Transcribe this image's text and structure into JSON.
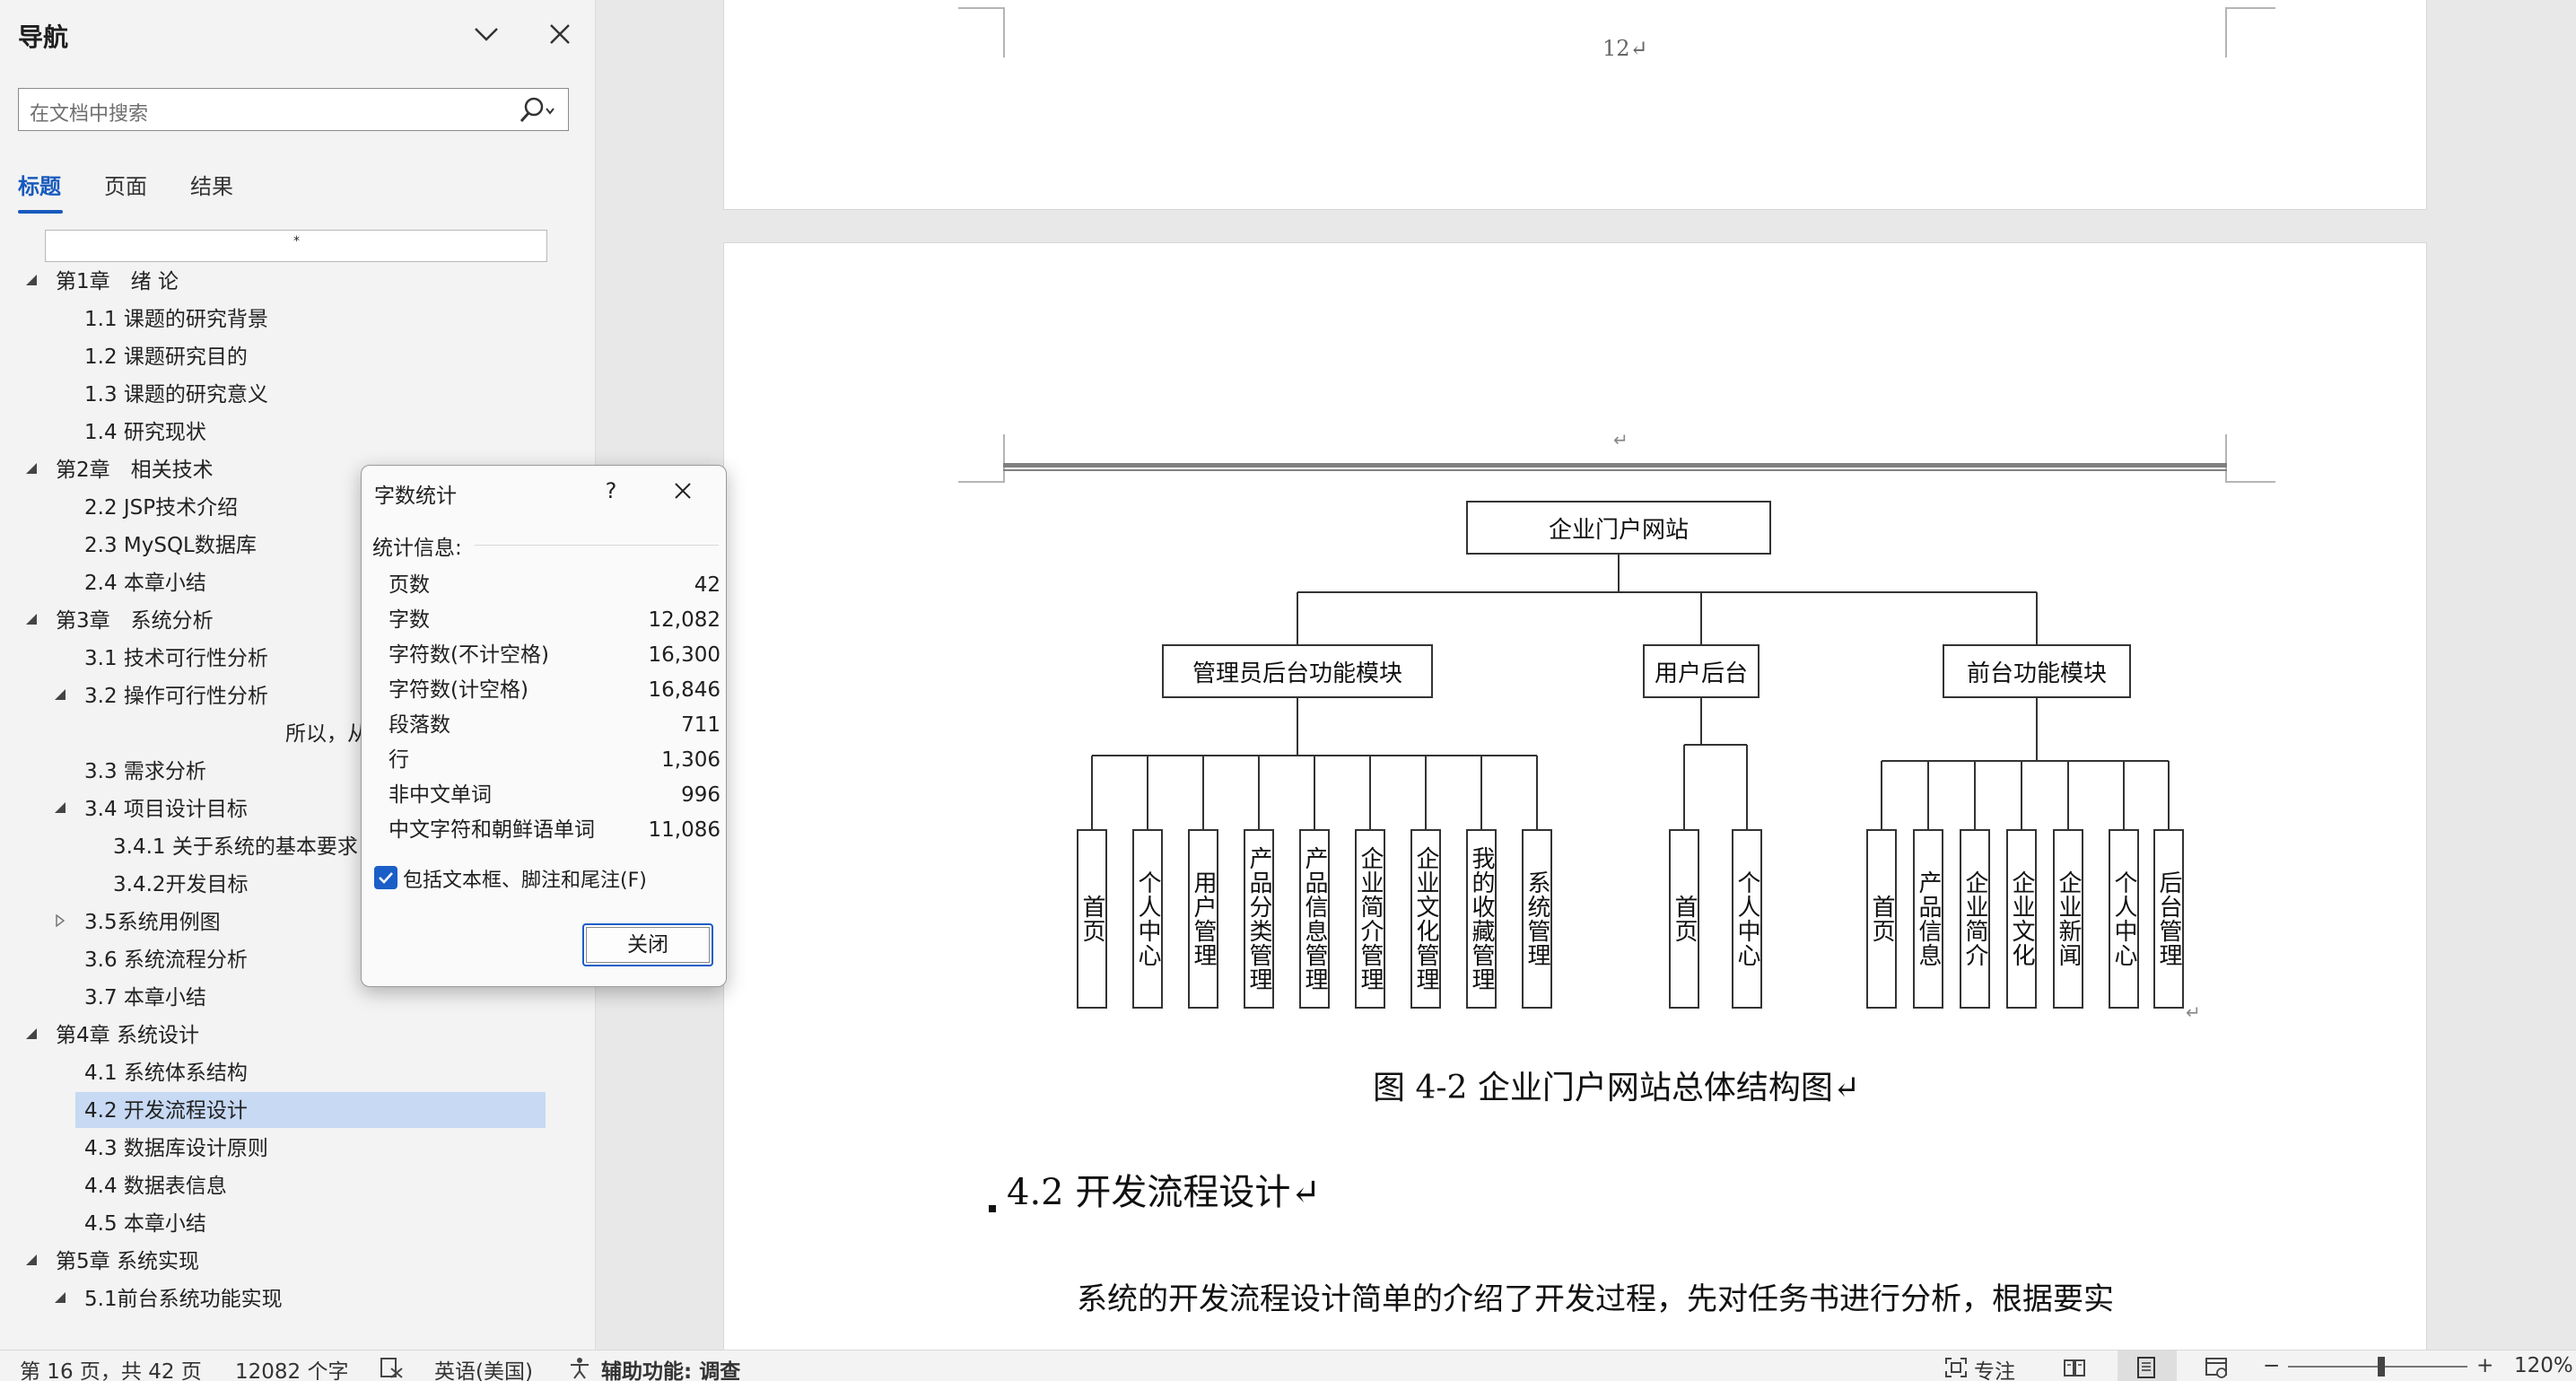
{
  "nav": {
    "title": "导航",
    "search_placeholder": "在文档中搜索",
    "tabs": [
      "标题",
      "页面",
      "结果"
    ],
    "scroll_marker": "*",
    "tree": [
      {
        "label": "第1章　绪 论",
        "level": 1,
        "expanded": true
      },
      {
        "label": "1.1 课题的研究背景",
        "level": 2
      },
      {
        "label": "1.2 课题研究目的",
        "level": 2
      },
      {
        "label": "1.3 课题的研究意义",
        "level": 2
      },
      {
        "label": "1.4 研究现状",
        "level": 2
      },
      {
        "label": "第2章　相关技术",
        "level": 1,
        "expanded": true
      },
      {
        "label": "2.2 JSP技术介绍",
        "level": 2
      },
      {
        "label": "2.3 MySQL数据库",
        "level": 2
      },
      {
        "label": "2.4 本章小结",
        "level": 2
      },
      {
        "label": "第3章　系统分析",
        "level": 1,
        "expanded": true
      },
      {
        "label": "3.1 技术可行性分析",
        "level": 2
      },
      {
        "label": "3.2  操作可行性分析",
        "level": 2,
        "expanded": true
      },
      {
        "label": "所以，从",
        "level": 4
      },
      {
        "label": "3.3 需求分析",
        "level": 2
      },
      {
        "label": "3.4 项目设计目标",
        "level": 2,
        "expanded": true
      },
      {
        "label": "3.4.1 关于系统的基本要求",
        "level": 3
      },
      {
        "label": "3.4.2开发目标",
        "level": 3
      },
      {
        "label": "3.5系统用例图",
        "level": 2,
        "collapsed": true
      },
      {
        "label": "3.6 系统流程分析",
        "level": 2
      },
      {
        "label": "3.7  本章小结",
        "level": 2
      },
      {
        "label": "第4章  系统设计",
        "level": 1,
        "expanded": true
      },
      {
        "label": "4.1 系统体系结构",
        "level": 2
      },
      {
        "label": "4.2  开发流程设计",
        "level": 2,
        "selected": true
      },
      {
        "label": "4.3  数据库设计原则",
        "level": 2
      },
      {
        "label": "4.4  数据表信息",
        "level": 2
      },
      {
        "label": "4.5  本章小结",
        "level": 2
      },
      {
        "label": "第5章  系统实现",
        "level": 1,
        "expanded": true
      },
      {
        "label": "5.1前台系统功能实现",
        "level": 2,
        "expanded": true
      }
    ]
  },
  "document": {
    "page_number": "12↵",
    "header_mark": "↵",
    "figure_return": "↵",
    "figure_caption": "图 4-2  企业门户网站总体结构图↵",
    "section_heading": "4.2   开发流程设计↵",
    "body_text": "系统的开发流程设计简单的介绍了开发过程，先对任务书进行分析，根据要实",
    "diagram": {
      "root": "企业门户网站",
      "modules": [
        {
          "name": "管理员后台功能模块",
          "children": [
            "首页",
            "个人中心",
            "用户管理",
            "产品分类管理",
            "产品信息管理",
            "企业简介管理",
            "企业文化管理",
            "我的收藏管理",
            "系统管理"
          ]
        },
        {
          "name": "用户后台",
          "children": [
            "首页",
            "个人中心"
          ]
        },
        {
          "name": "前台功能模块",
          "children": [
            "首页",
            "产品信息",
            "企业简介",
            "企业文化",
            "企业新闻",
            "个人中心",
            "后台管理"
          ]
        }
      ]
    }
  },
  "dialog": {
    "title": "字数统计",
    "help": "?",
    "section": "统计信息:",
    "stats": [
      {
        "label": "页数",
        "value": "42"
      },
      {
        "label": "字数",
        "value": "12,082"
      },
      {
        "label": "字符数(不计空格)",
        "value": "16,300"
      },
      {
        "label": "字符数(计空格)",
        "value": "16,846"
      },
      {
        "label": "段落数",
        "value": "711"
      },
      {
        "label": "行",
        "value": "1,306"
      },
      {
        "label": "非中文单词",
        "value": "996"
      },
      {
        "label": "中文字符和朝鲜语单词",
        "value": "11,086"
      }
    ],
    "checkbox_label": "包括文本框、脚注和尾注(F)",
    "checkbox_checked": true,
    "close_button": "关闭"
  },
  "status": {
    "page": "第 16 页，共 42 页",
    "words": "12082 个字",
    "language": "英语(美国)",
    "accessibility": "辅助功能: 调查",
    "focus": "专注",
    "zoom_level": "120%",
    "zoom_minus": "−",
    "zoom_plus": "+"
  },
  "colors": {
    "accent": "#185abd",
    "selection": "#c7d9f3"
  }
}
